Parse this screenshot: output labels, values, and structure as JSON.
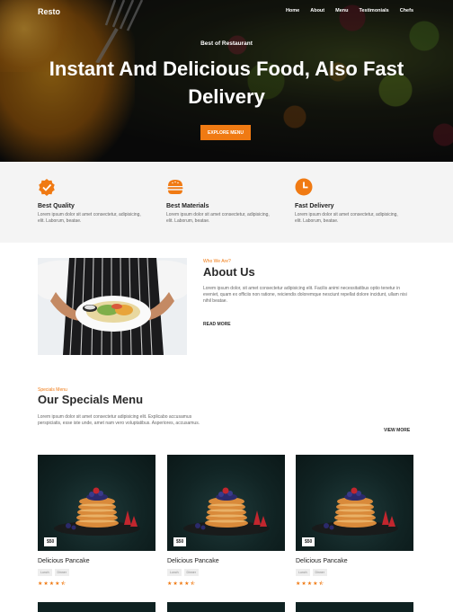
{
  "nav": {
    "logo": "Resto",
    "links": [
      "Home",
      "About",
      "Menu",
      "Testimonials",
      "Chefs"
    ]
  },
  "hero": {
    "subtitle": "Best of Restaurant",
    "title": "Instant And Delicious Food, Also Fast Delivery",
    "button": "EXPLORE MENU"
  },
  "features": [
    {
      "icon": "badge-check-icon",
      "title": "Best Quality",
      "text": "Lorem ipsum dolor sit amet consectetur, adipisicing, elit. Laborum, beatae."
    },
    {
      "icon": "burger-icon",
      "title": "Best Materials",
      "text": "Lorem ipsum dolor sit amet consectetur, adipisicing, elit. Laborum, beatae."
    },
    {
      "icon": "clock-icon",
      "title": "Fast Delivery",
      "text": "Lorem ipsum dolor sit amet consectetur, adipisicing, elit. Laborum, beatae."
    }
  ],
  "about": {
    "eyebrow": "Who We Are?",
    "title": "About Us",
    "text": "Lorem ipsum dolor, sit amet consectetur adipisicing elit. Facilis animi necessitatibus optio tenetur in eveniet, quam ex officiis non ratione, reiciendis doloremque nesciunt repellat dolore incidunt, ullam nisi nihil beatae.",
    "link": "READ MORE"
  },
  "specials": {
    "eyebrow": "Specials Menu",
    "title": "Our Specials Menu",
    "text": "Lorem ipsum dolor sit amet consectetur adipisicing elit. Explicabo accusamus perspiciatis, esse iste unde, amet nam vero voluptatibus. Asperiores, accusamus.",
    "view_more": "VIEW MORE",
    "cards": [
      {
        "name": "Delicious Pancake",
        "price": "$50",
        "tags": [
          "Lunch",
          "Dinner"
        ],
        "rating": 4.5
      },
      {
        "name": "Delicious Pancake",
        "price": "$50",
        "tags": [
          "Lunch",
          "Dinner"
        ],
        "rating": 4.5
      },
      {
        "name": "Delicious Pancake",
        "price": "$50",
        "tags": [
          "Lunch",
          "Dinner"
        ],
        "rating": 4.5
      }
    ]
  },
  "colors": {
    "accent": "#f07a13",
    "dark": "#2a2a2a",
    "section_bg": "#f4f4f4"
  }
}
